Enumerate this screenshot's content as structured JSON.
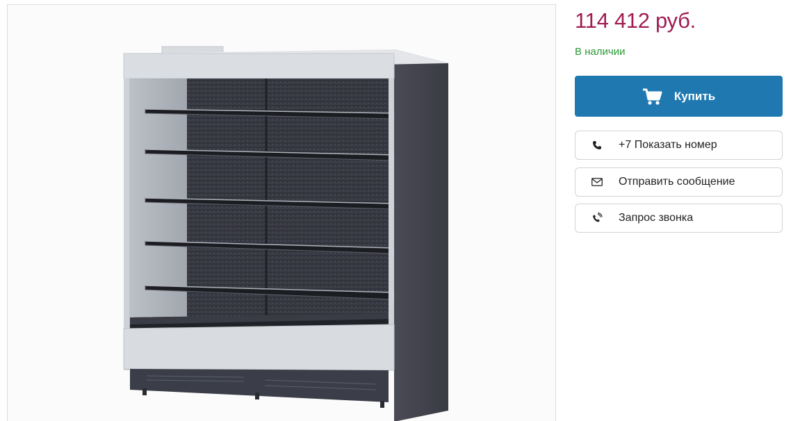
{
  "product": {
    "price": "114 412 руб.",
    "availability": "В наличии",
    "image_alt": "Холодильная горка"
  },
  "actions": {
    "buy_label": "Купить",
    "phone_label": "+7 Показать номер",
    "message_label": "Отправить сообщение",
    "callback_label": "Запрос звонка"
  },
  "colors": {
    "price": "#a01c52",
    "availability": "#2b9a36",
    "buy_button": "#1f79b0"
  },
  "icons": {
    "buy": "cart-icon",
    "phone": "phone-icon",
    "message": "envelope-icon",
    "callback": "phone-ringing-icon"
  }
}
